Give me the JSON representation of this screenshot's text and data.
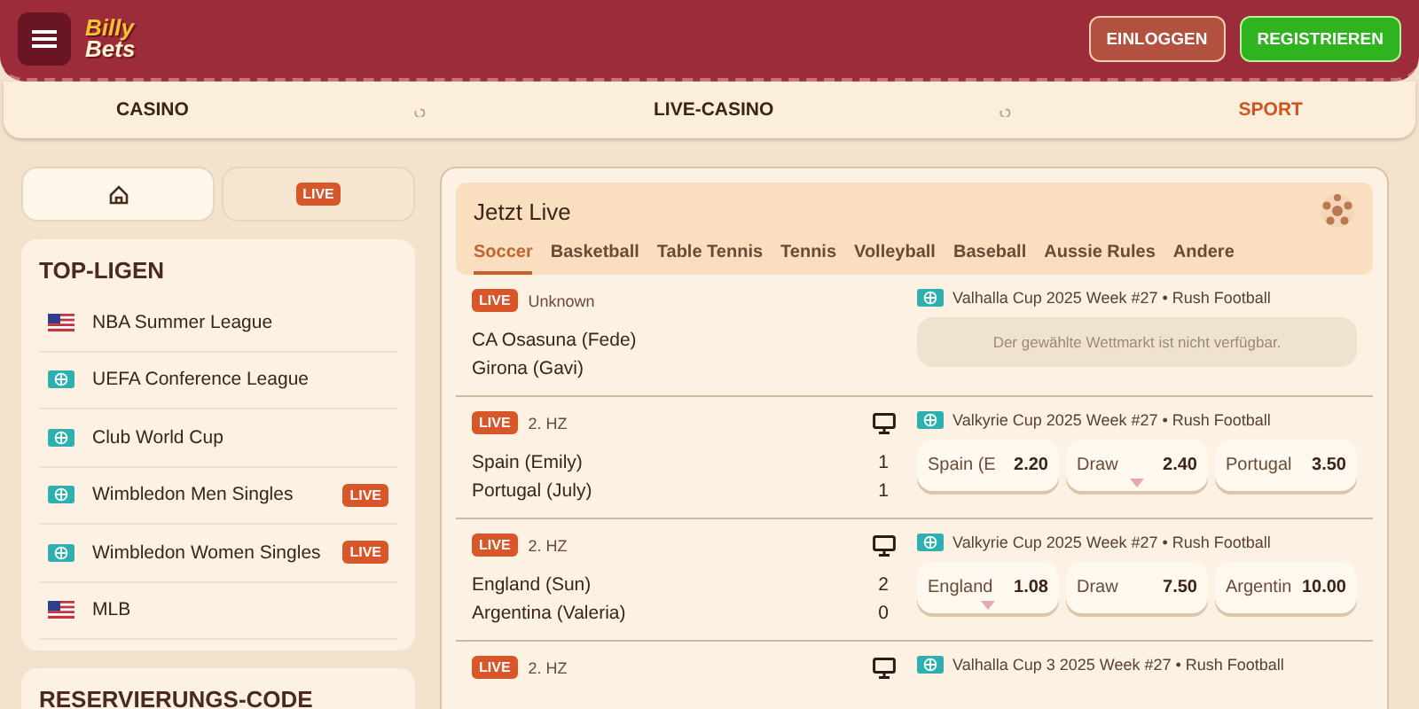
{
  "header": {
    "logo": [
      "Billy",
      "Bets"
    ],
    "buttons": [
      {
        "label": "EINLOGGEN",
        "kind": "login"
      },
      {
        "label": "REGISTRIEREN",
        "kind": "register"
      }
    ]
  },
  "nav": [
    {
      "label": "CASINO",
      "selected": false
    },
    {
      "label": "LIVE-CASINO",
      "selected": false
    },
    {
      "label": "SPORT",
      "selected": true
    }
  ],
  "side_tabs": [
    {
      "kind": "home",
      "selected": true
    },
    {
      "kind": "live",
      "label": "LIVE",
      "selected": false
    }
  ],
  "top_leagues": {
    "title": "TOP-LIGEN",
    "items": [
      {
        "name": "NBA Summer League",
        "kind": "us"
      },
      {
        "name": "UEFA Conference League",
        "kind": "world"
      },
      {
        "name": "Club World Cup",
        "kind": "world"
      },
      {
        "name": "Wimbledon Men Singles",
        "kind": "world",
        "badge": "LIVE"
      },
      {
        "name": "Wimbledon Women Singles",
        "kind": "world",
        "badge": "LIVE"
      },
      {
        "name": "MLB",
        "kind": "us"
      }
    ]
  },
  "booking": {
    "title": "RESERVIERUNGS-CODE"
  },
  "live": {
    "title": "Jetzt Live",
    "tabs": [
      {
        "label": "Soccer",
        "selected": true
      },
      {
        "label": "Basketball",
        "selected": false
      },
      {
        "label": "Table Tennis",
        "selected": false
      },
      {
        "label": "Tennis",
        "selected": false
      },
      {
        "label": "Volleyball",
        "selected": false
      },
      {
        "label": "Baseball",
        "selected": false
      },
      {
        "label": "Aussie Rules",
        "selected": false
      },
      {
        "label": "Andere",
        "selected": false
      }
    ],
    "matches": [
      {
        "badge": "LIVE",
        "period": "Unknown",
        "stream": false,
        "league": "Valhalla Cup 2025 Week #27 • Rush Football",
        "teams": [
          {
            "name": "CA Osasuna (Fede)"
          },
          {
            "name": "Girona (Gavi)"
          }
        ],
        "unavailable": "Der gewählte Wettmarkt ist nicht verfügbar."
      },
      {
        "badge": "LIVE",
        "period": "2. HZ",
        "stream": true,
        "league": "Valkyrie Cup 2025 Week #27 • Rush Football",
        "teams": [
          {
            "name": "Spain (Emily)",
            "score": "1"
          },
          {
            "name": "Portugal (July)",
            "score": "1"
          }
        ],
        "odds": [
          {
            "label": "Spain (E",
            "value": "2.20",
            "kind": "plain"
          },
          {
            "label": "Draw",
            "value": "2.40",
            "kind": "falling"
          },
          {
            "label": "Portugal",
            "value": "3.50",
            "kind": "plain"
          }
        ]
      },
      {
        "badge": "LIVE",
        "period": "2. HZ",
        "stream": true,
        "league": "Valkyrie Cup 2025 Week #27 • Rush Football",
        "teams": [
          {
            "name": "England (Sun)",
            "score": "2"
          },
          {
            "name": "Argentina (Valeria)",
            "score": "0"
          }
        ],
        "odds": [
          {
            "label": "England",
            "value": "1.08",
            "kind": "falling"
          },
          {
            "label": "Draw",
            "value": "7.50",
            "kind": "plain"
          },
          {
            "label": "Argentin",
            "value": "10.00",
            "kind": "plain"
          }
        ]
      },
      {
        "badge": "LIVE",
        "period": "2. HZ",
        "stream": true,
        "league": "Valhalla Cup 3 2025 Week #27 • Rush Football"
      }
    ]
  }
}
